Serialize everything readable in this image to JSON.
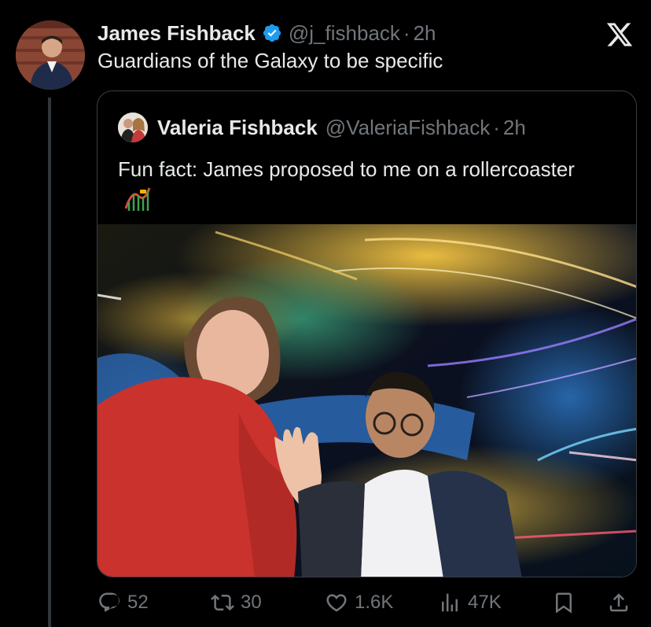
{
  "tweet": {
    "author": {
      "display_name": "James Fishback",
      "handle": "@j_fishback",
      "verified": true,
      "avatar_icon": "profile-photo"
    },
    "separator": "·",
    "time": "2h",
    "text": "Guardians of the Galaxy to be specific"
  },
  "quote": {
    "author": {
      "display_name": "Valeria Fishback",
      "handle": "@ValeriaFishback",
      "avatar_icon": "profile-photo"
    },
    "separator": "·",
    "time": "2h",
    "text": "Fun fact: James proposed to me on a rollercoaster",
    "emoji": "roller-coaster-emoji",
    "media": "photo of a couple on a rollercoaster with light streaks"
  },
  "actions": {
    "replies": "52",
    "reposts": "30",
    "likes": "1.6K",
    "views": "47K"
  },
  "colors": {
    "background": "#000000",
    "text": "#e7e9ea",
    "secondary": "#71767b",
    "verified": "#1d9bf0",
    "border": "#3a3d40"
  },
  "icons": [
    "x-logo-icon",
    "verified-badge-icon",
    "reply-icon",
    "repost-icon",
    "like-icon",
    "views-icon",
    "bookmark-icon",
    "share-icon"
  ]
}
